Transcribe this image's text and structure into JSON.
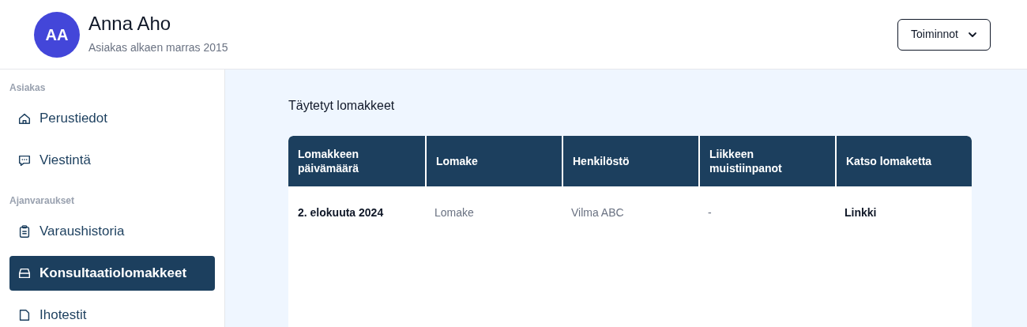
{
  "header": {
    "avatar": "AA",
    "name": "Anna Aho",
    "subtitle": "Asiakas alkaen marras 2015",
    "actions_button": "Toiminnot"
  },
  "sidebar": {
    "sections": [
      {
        "label": "Asiakas",
        "items": [
          {
            "label": "Perustiedot",
            "selected": false
          },
          {
            "label": "Viestintä",
            "selected": false
          }
        ]
      },
      {
        "label": "Ajanvaraukset",
        "items": [
          {
            "label": "Varaushistoria",
            "selected": false
          },
          {
            "label": "Konsultaatiolomakkeet",
            "selected": true
          },
          {
            "label": "Ihotestit",
            "selected": false
          }
        ]
      }
    ]
  },
  "main": {
    "title": "Täytetyt lomakkeet",
    "table": {
      "columns": [
        "Lomakkeen päivämäärä",
        "Lomake",
        "Henkilöstö",
        "Liikkeen muistiinpanot",
        "Katso lomaketta"
      ],
      "rows": [
        [
          "2. elokuuta 2024",
          "Lomake",
          "Vilma ABC",
          "-",
          "Linkki"
        ]
      ]
    }
  }
}
